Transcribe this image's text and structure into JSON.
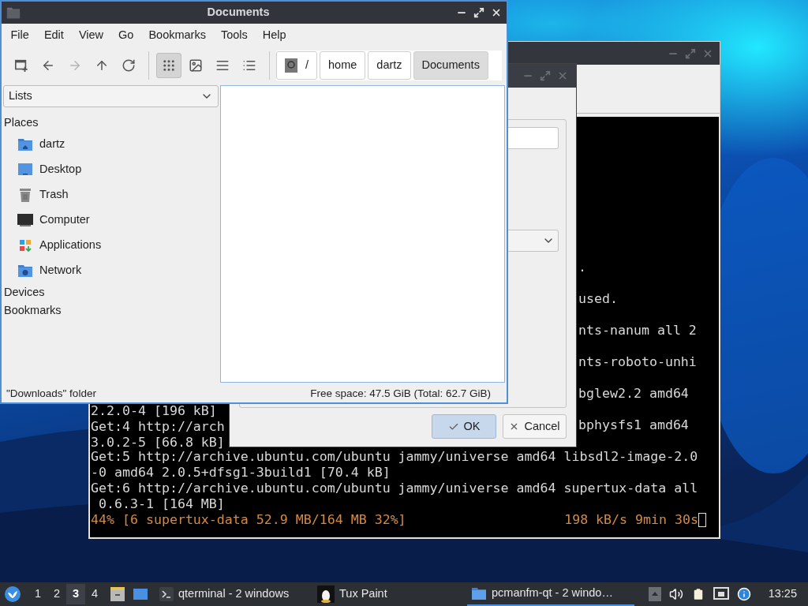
{
  "file_manager": {
    "title": "Documents",
    "menu": [
      "File",
      "Edit",
      "View",
      "Go",
      "Bookmarks",
      "Tools",
      "Help"
    ],
    "nav_buttons": [
      {
        "kind": "new_tab",
        "disabled": false
      },
      {
        "kind": "back",
        "disabled": false
      },
      {
        "kind": "forward",
        "disabled": true
      },
      {
        "kind": "up",
        "disabled": false
      },
      {
        "kind": "reload",
        "disabled": false
      }
    ],
    "view_modes": [
      {
        "kind": "icon",
        "selected": true
      },
      {
        "kind": "thumbnail",
        "selected": false
      },
      {
        "kind": "compact",
        "selected": false
      },
      {
        "kind": "detailed",
        "selected": false
      }
    ],
    "path": [
      {
        "label": "/",
        "kind": "root",
        "selected": false
      },
      {
        "label": "home",
        "kind": "dir",
        "selected": false
      },
      {
        "label": "dartz",
        "kind": "dir",
        "selected": false
      },
      {
        "label": "Documents",
        "kind": "dir",
        "selected": true
      }
    ],
    "side_panel": {
      "mode": "Lists",
      "sections": [
        {
          "title": "Places",
          "items": [
            {
              "label": "dartz",
              "kind": "home"
            },
            {
              "label": "Desktop",
              "kind": "desktop"
            },
            {
              "label": "Trash",
              "kind": "trash"
            },
            {
              "label": "Computer",
              "kind": "computer"
            },
            {
              "label": "Applications",
              "kind": "applications"
            },
            {
              "label": "Network",
              "kind": "network"
            }
          ]
        },
        {
          "title": "Devices"
        },
        {
          "title": "Bookmarks"
        }
      ]
    },
    "status_bar": {
      "left": "\"Downloads\" folder",
      "right": "Free space: 47.5 GiB (Total: 62.7 GiB)"
    }
  },
  "dialog": {
    "buttons": [
      {
        "label": "OK",
        "kind": "ok",
        "default": true
      },
      {
        "label": "Cancel",
        "kind": "cancel",
        "default": false
      }
    ]
  },
  "terminal": {
    "lines": [
      {
        "kind": "split",
        "right": "."
      },
      {
        "kind": "blank"
      },
      {
        "kind": "split",
        "right": "used."
      },
      {
        "kind": "blank"
      },
      {
        "kind": "split",
        "right": "nts-nanum all 2"
      },
      {
        "kind": "blank"
      },
      {
        "kind": "split",
        "right": "nts-roboto-unhi"
      },
      {
        "kind": "blank"
      },
      {
        "kind": "split",
        "right": "bglew2.2 amd64"
      },
      {
        "kind": "split",
        "left": "2.2.0-4 [196 kB]"
      },
      {
        "kind": "split",
        "left": "Get:4 http://arch",
        "right": "bphysfs1 amd64"
      },
      {
        "kind": "split",
        "left": "3.0.2-5 [66.8 kB]"
      },
      {
        "kind": "full",
        "text": "Get:5 http://archive.ubuntu.com/ubuntu jammy/universe amd64 libsdl2-image-2.0"
      },
      {
        "kind": "full",
        "text": "-0 amd64 2.0.5+dfsg1-3build1 [70.4 kB]"
      },
      {
        "kind": "full",
        "text": "Get:6 http://archive.ubuntu.com/ubuntu jammy/universe amd64 supertux-data all"
      },
      {
        "kind": "full",
        "text": " 0.6.3-1 [164 MB]"
      },
      {
        "kind": "progress",
        "left": "44% [6 supertux-data 52.9 MB/164 MB 32%]",
        "right": "198 kB/s 9min 30s"
      }
    ]
  },
  "taskbar": {
    "workspaces": [
      {
        "label": "1",
        "selected": false
      },
      {
        "label": "2",
        "selected": false
      },
      {
        "label": "3",
        "selected": true
      },
      {
        "label": "4",
        "selected": false
      }
    ],
    "launchers": [
      {
        "kind": "file_manager"
      },
      {
        "kind": "folder"
      }
    ],
    "tasks": [
      {
        "label": "qterminal - 2 windows",
        "kind": "terminal",
        "selected": false
      },
      {
        "label": "Tux Paint",
        "kind": "paint",
        "selected": false
      },
      {
        "label": "pcmanfm-qt - 2 windo…",
        "kind": "folder",
        "selected": true
      }
    ],
    "tray": [
      {
        "kind": "expand"
      },
      {
        "kind": "volume"
      },
      {
        "kind": "clipboard"
      },
      {
        "kind": "network"
      },
      {
        "kind": "notification"
      }
    ],
    "clock": "13:25"
  }
}
